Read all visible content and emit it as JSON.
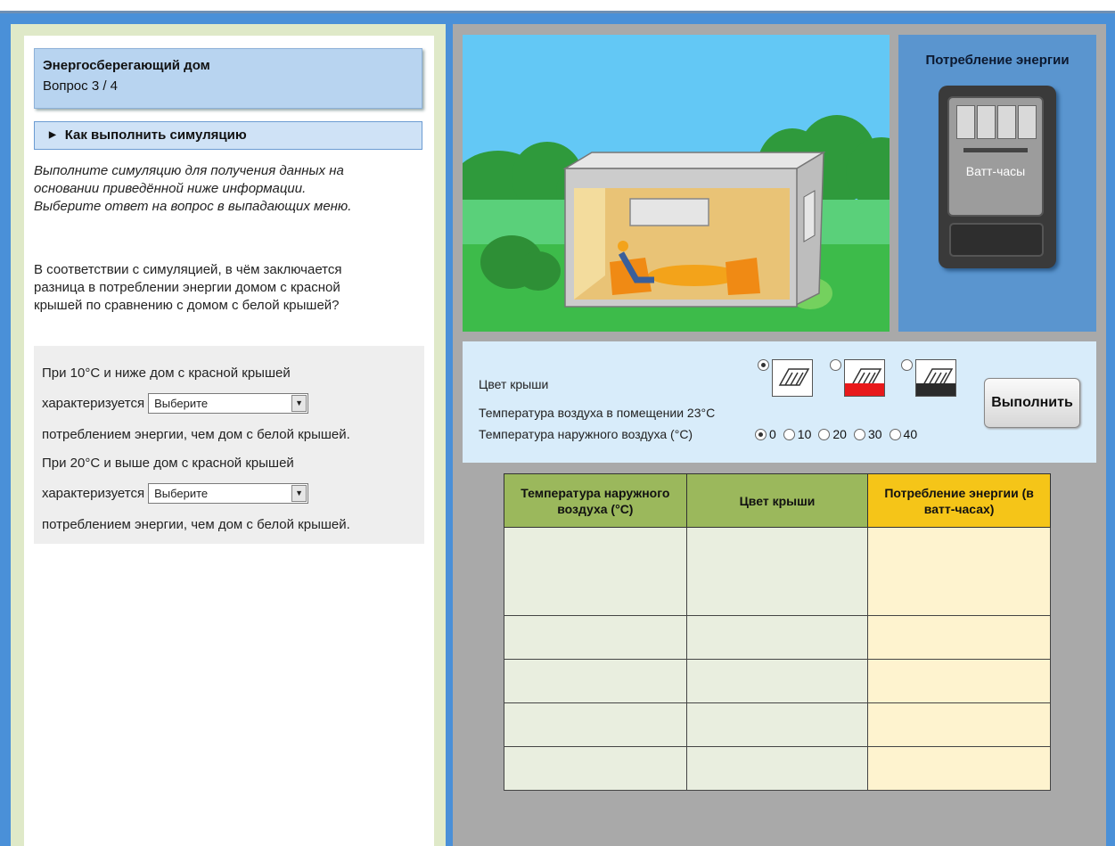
{
  "left": {
    "title": "Энергосберегающий дом",
    "question_counter": "Вопрос 3 / 4",
    "how_to_label": "Как выполнить симуляцию",
    "instructions": [
      "Выполните симуляцию для получения данных на",
      "основании приведённой ниже информации.",
      "Выберите ответ на вопрос в выпадающих меню."
    ],
    "question": [
      "В соответствии с симуляцией, в чём заключается",
      "разница в потреблении энергии домом с красной",
      "крышей по сравнению с домом с белой крышей?"
    ],
    "answer": {
      "line1": "При 10°C и ниже дом с красной крышей",
      "line2_prefix": "характеризуется",
      "select1_value": "Выберите",
      "line3": "потреблением энергии, чем дом с белой крышей.",
      "line4": "При 20°C и выше дом с красной крышей",
      "line5_prefix": "характеризуется",
      "select2_value": "Выберите",
      "line6": "потреблением энергии, чем дом с белой крышей."
    }
  },
  "energy_panel": {
    "title": "Потребление энергии",
    "meter_unit": "Ватт-часы"
  },
  "controls": {
    "roof_color_label": "Цвет крыши",
    "roof_options": [
      {
        "name": "white",
        "color": "#ffffff",
        "selected": true
      },
      {
        "name": "red",
        "color": "#e8191b",
        "selected": false
      },
      {
        "name": "black",
        "color": "#2b2b2b",
        "selected": false
      }
    ],
    "indoor_temp_label": "Температура воздуха в помещении 23°C",
    "outdoor_temp_label": "Температура наружного воздуха (°C)",
    "outdoor_temps": [
      "0",
      "10",
      "20",
      "30",
      "40"
    ],
    "outdoor_selected": "0",
    "run_label": "Выполнить"
  },
  "table": {
    "headers": [
      "Температура наружного воздуха (°C)",
      "Цвет крыши",
      "Потребление энергии (в ватт-часах)"
    ],
    "rows": [
      [
        "",
        "",
        ""
      ],
      [
        "",
        "",
        ""
      ],
      [
        "",
        "",
        ""
      ],
      [
        "",
        "",
        ""
      ],
      [
        "",
        "",
        ""
      ]
    ]
  },
  "colors": {
    "frame": "#4a90d8",
    "table_header_green": "#9bb85c",
    "table_header_yellow": "#f5c518",
    "sky": "#63c8f5",
    "grass": "#3dbb4a"
  }
}
